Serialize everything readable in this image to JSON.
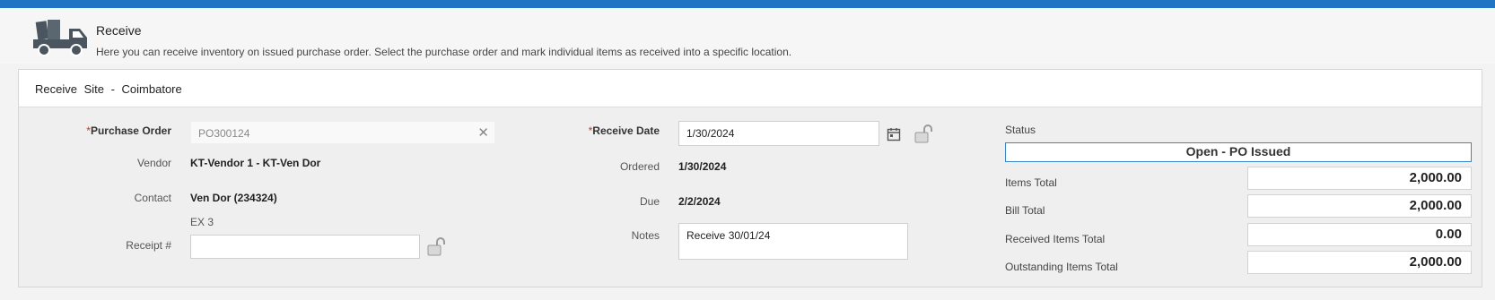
{
  "colors": {
    "topbar": "#1f75c4",
    "status_border": "#3a86c6",
    "required": "#c0392b"
  },
  "header": {
    "icon": "truck-icon",
    "title": "Receive",
    "subtitle": "Here you can receive inventory on issued purchase order. Select the purchase order and mark individual items as received into a specific location."
  },
  "panel": {
    "title": "Receive  Site - Coimbatore"
  },
  "left": {
    "purchase_order_label": "Purchase Order",
    "purchase_order_value": "PO300124",
    "vendor_label": "Vendor",
    "vendor_value": "KT-Vendor 1 - KT-Ven Dor",
    "contact_label": "Contact",
    "contact_value": "Ven Dor (234324)",
    "contact_ext": "EX 3",
    "receipt_label": "Receipt #",
    "receipt_value": ""
  },
  "middle": {
    "receive_date_label": "Receive Date",
    "receive_date_value": "1/30/2024",
    "ordered_label": "Ordered",
    "ordered_value": "1/30/2024",
    "due_label": "Due",
    "due_value": "2/2/2024",
    "notes_label": "Notes",
    "notes_value": "Receive 30/01/24"
  },
  "right": {
    "status_label": "Status",
    "status_value": "Open - PO Issued",
    "items_total_label": "Items Total",
    "items_total_value": "2,000.00",
    "bill_total_label": "Bill Total",
    "bill_total_value": "2,000.00",
    "received_items_total_label": "Received Items Total",
    "received_items_total_value": "0.00",
    "outstanding_items_total_label": "Outstanding Items Total",
    "outstanding_items_total_value": "2,000.00"
  }
}
